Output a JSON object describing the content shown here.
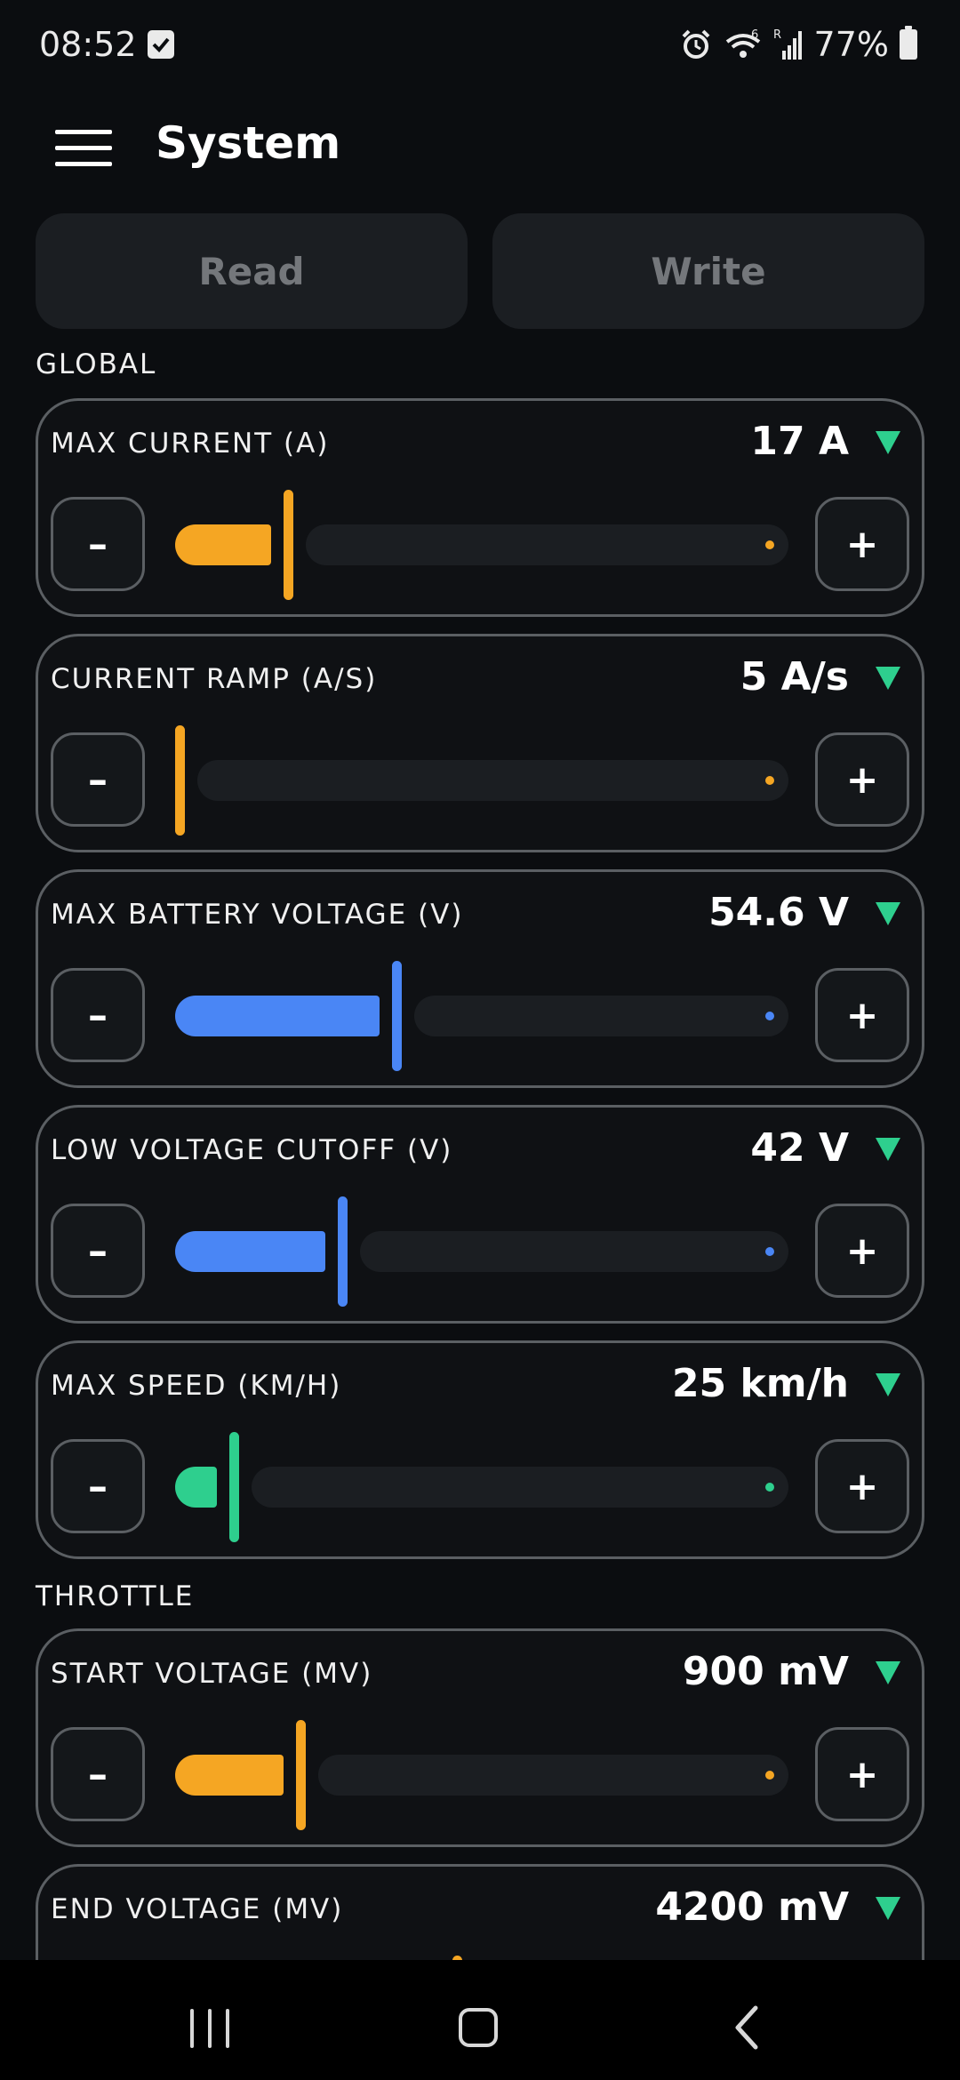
{
  "status_bar": {
    "time": "08:52",
    "battery": "77%",
    "network_badge": "6",
    "roaming": "R"
  },
  "app_bar": {
    "title": "System"
  },
  "actions": {
    "read": "Read",
    "write": "Write"
  },
  "sections": [
    {
      "label": "GLOBAL"
    },
    {
      "label": "THROTTLE"
    }
  ],
  "colors": {
    "orange": "#f5a623",
    "blue": "#4a86f5",
    "green": "#2ecf8e",
    "background": "#0b0d10"
  },
  "cards": [
    {
      "title": "MAX CURRENT (A)",
      "value": "17 A",
      "fraction": 0.18,
      "color": "orange"
    },
    {
      "title": "CURRENT RAMP (A/S)",
      "value": "5 A/s",
      "fraction": 0.0,
      "color": "orange"
    },
    {
      "title": "MAX BATTERY VOLTAGE (V)",
      "value": "54.6 V",
      "fraction": 0.36,
      "color": "blue"
    },
    {
      "title": "LOW VOLTAGE CUTOFF (V)",
      "value": "42 V",
      "fraction": 0.27,
      "color": "blue"
    },
    {
      "title": "MAX SPEED (KM/H)",
      "value": "25 km/h",
      "fraction": 0.09,
      "color": "green"
    },
    {
      "title": "START VOLTAGE (MV)",
      "value": "900 mV",
      "fraction": 0.2,
      "color": "orange"
    },
    {
      "title": "END VOLTAGE (MV)",
      "value": "4200 mV",
      "fraction": 0.46,
      "color": "orange"
    }
  ],
  "stepper": {
    "minus": "–",
    "plus": "+"
  }
}
